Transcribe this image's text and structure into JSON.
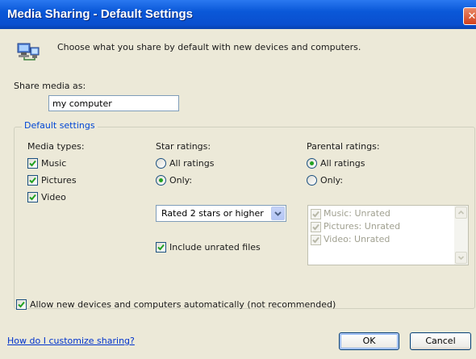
{
  "window": {
    "title": "Media Sharing - Default Settings",
    "close_glyph": "✕"
  },
  "header": {
    "description": "Choose what you share by default with new devices and computers.",
    "icon": "network-computers-icon"
  },
  "share_media": {
    "label": "Share media as:",
    "value": "my computer"
  },
  "default_settings": {
    "legend": "Default settings",
    "media_types": {
      "heading": "Media types:",
      "items": [
        {
          "label": "Music",
          "checked": true
        },
        {
          "label": "Pictures",
          "checked": true
        },
        {
          "label": "Video",
          "checked": true
        }
      ]
    },
    "star_ratings": {
      "heading": "Star ratings:",
      "options": [
        {
          "label": "All ratings",
          "selected": false
        },
        {
          "label": "Only:",
          "selected": true
        }
      ],
      "dropdown_value": "Rated 2 stars or higher",
      "include_unrated_label": "Include unrated files",
      "include_unrated_checked": true
    },
    "parental_ratings": {
      "heading": "Parental ratings:",
      "options": [
        {
          "label": "All ratings",
          "selected": true
        },
        {
          "label": "Only:",
          "selected": false
        }
      ],
      "list_items": [
        {
          "label": "Music: Unrated",
          "checked": true
        },
        {
          "label": "Pictures: Unrated",
          "checked": true
        },
        {
          "label": "Video: Unrated",
          "checked": true
        }
      ]
    }
  },
  "allow_new_devices": {
    "label": "Allow new devices and computers automatically (not recommended)",
    "checked": true
  },
  "footer": {
    "help_link": "How do I customize sharing?",
    "ok_label": "OK",
    "cancel_label": "Cancel"
  },
  "colors": {
    "titlebar": "#0a58d8",
    "dialog_bg": "#ece9d8",
    "group_legend": "#0046d5",
    "link": "#0033cc",
    "radio_dot": "#21a121"
  }
}
